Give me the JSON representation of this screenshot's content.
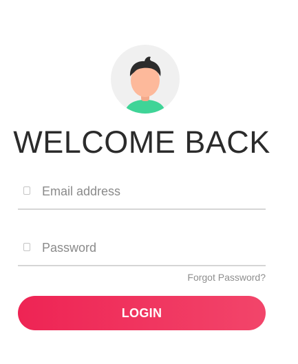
{
  "header": {
    "avatar_icon": "user-avatar-icon",
    "title": "WELCOME BACK"
  },
  "form": {
    "email": {
      "icon": "mail-icon",
      "placeholder": "Email address",
      "value": ""
    },
    "password": {
      "icon": "lock-icon",
      "placeholder": "Password",
      "value": ""
    },
    "forgot_label": "Forgot Password?",
    "login_label": "LOGIN"
  },
  "colors": {
    "accent_start": "#ee2454",
    "accent_end": "#f2456a",
    "avatar_bg": "#f0f0f0",
    "shirt": "#3fd497",
    "skin": "#fdb99b",
    "hair": "#2c2c2c",
    "title_text": "#2b2b2b",
    "placeholder_text": "#8a8a8a",
    "divider": "#d5d5d5"
  }
}
